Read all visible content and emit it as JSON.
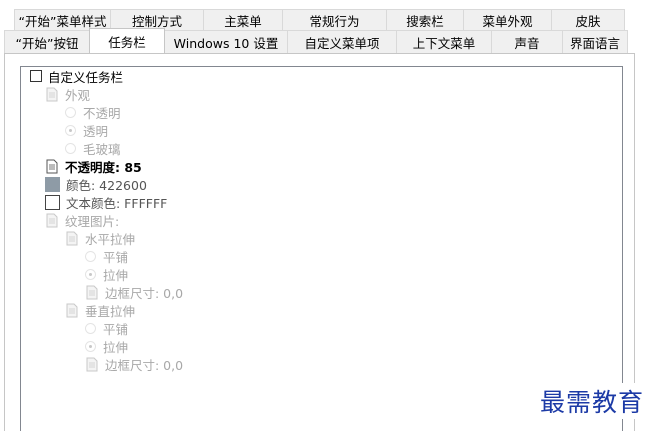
{
  "tabs": {
    "row_top": [
      "“开始”菜单样式",
      "控制方式",
      "主菜单",
      "常规行为",
      "搜索栏",
      "菜单外观",
      "皮肤"
    ],
    "row_bottom": [
      "“开始”按钮",
      "任务栏",
      "Windows 10 设置",
      "自定义菜单项",
      "上下文菜单",
      "声音",
      "界面语言"
    ],
    "active": "任务栏"
  },
  "settings": {
    "custom_taskbar": "自定义任务栏",
    "appearance": "外观",
    "opaque": "不透明",
    "transparent": "透明",
    "frosted": "毛玻璃",
    "opacity": "不透明度: 85",
    "color": "颜色: 422600",
    "text_color": "文本颜色: FFFFFF",
    "texture": "纹理图片:",
    "horizontal_stretch": "水平拉伸",
    "h_tile": "平铺",
    "h_stretch": "拉伸",
    "h_border": "边框尺寸: 0,0",
    "vertical_stretch": "垂直拉伸",
    "v_tile": "平铺",
    "v_stretch": "拉伸",
    "v_border": "边框尺寸: 0,0"
  },
  "colors": {
    "color_swatch": "#8e9ba6",
    "text_swatch": "#ffffff"
  },
  "watermark": "最需教育"
}
